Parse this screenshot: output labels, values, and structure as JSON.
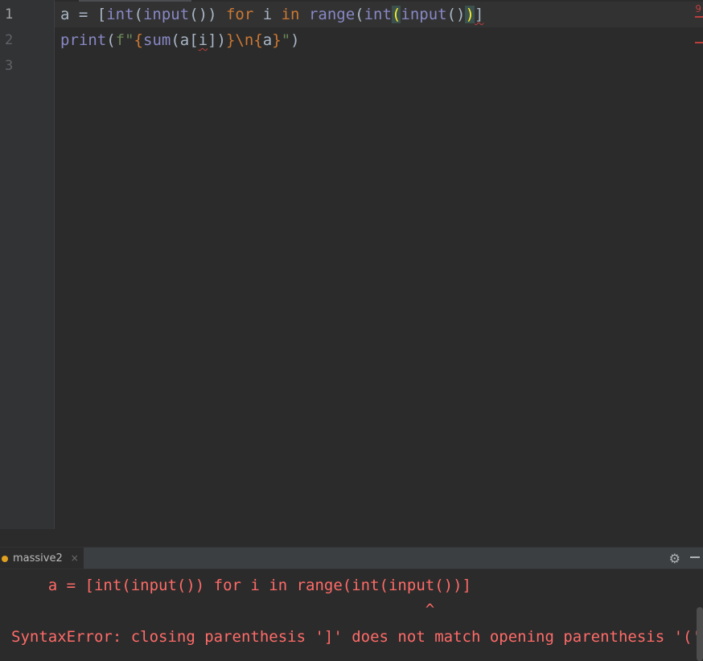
{
  "editor": {
    "line_numbers": [
      "1",
      "2",
      "3"
    ],
    "line1": {
      "p1": "a = [",
      "int1": "int",
      "p2": "(",
      "input1": "input",
      "p3": "()) ",
      "for": "for",
      "p4": " i ",
      "in": "in",
      "p5": " ",
      "range": "range",
      "p6": "(",
      "int2": "int",
      "paren_open": "(",
      "input2": "input",
      "p7": "()",
      "paren_close": ")",
      "p8": "]"
    },
    "line2": {
      "print": "print",
      "p1": "(",
      "fprefix": "f\"",
      "brace1": "{",
      "sum": "sum",
      "p2": "(a[",
      "i": "i",
      "p3": "])",
      "brace2": "}",
      "newline": "\\n",
      "brace3": "{",
      "a": "a",
      "brace4": "}",
      "quote": "\"",
      "p4": ")"
    },
    "gutter_error_label": "9"
  },
  "run_panel": {
    "tab_label": "massive2",
    "close_symbol": "×",
    "settings_icon": "gear-icon",
    "output": [
      "    a = [int(input()) for i in range(int(input())]",
      "                                             ^",
      "SyntaxError: closing parenthesis ']' does not match opening parenthesis '('"
    ]
  },
  "colors": {
    "background": "#2b2b2b",
    "keyword": "#cc7832",
    "builtin": "#8888c6",
    "error": "#ff6b68"
  }
}
